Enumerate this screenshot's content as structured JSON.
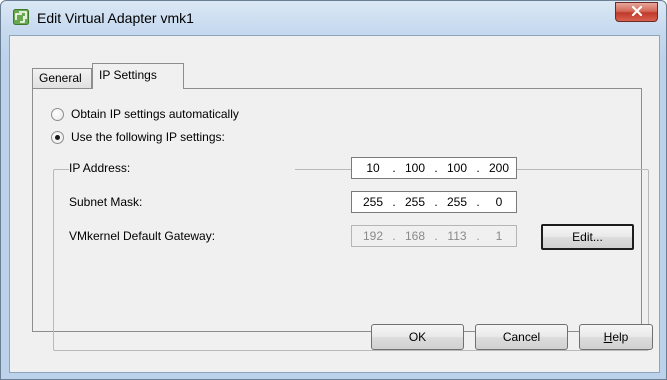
{
  "window": {
    "title": "Edit Virtual Adapter vmk1",
    "close_glyph": "X",
    "app_icon": "vmware-app-icon",
    "accent_color": "#c0392b"
  },
  "tabs": [
    {
      "label": "General",
      "selected": false
    },
    {
      "label": "IP Settings",
      "selected": true
    }
  ],
  "ip_settings": {
    "mode_auto": {
      "label": "Obtain IP settings automatically",
      "checked": false
    },
    "mode_manual": {
      "label": "Use the following IP settings:",
      "checked": true
    },
    "fields": {
      "ip_address": {
        "label": "IP Address:",
        "octets": [
          "10",
          "100",
          "100",
          "200"
        ],
        "enabled": true
      },
      "subnet_mask": {
        "label": "Subnet Mask:",
        "octets": [
          "255",
          "255",
          "255",
          "0"
        ],
        "enabled": true
      },
      "gateway": {
        "label": "VMkernel Default Gateway:",
        "octets": [
          "192",
          "168",
          "113",
          "1"
        ],
        "enabled": false
      }
    },
    "edit_label": "Edit..."
  },
  "footer": {
    "ok_label": "OK",
    "cancel_label": "Cancel",
    "help_label": "Help",
    "help_mnemonic": "H",
    "help_rest": "elp"
  }
}
